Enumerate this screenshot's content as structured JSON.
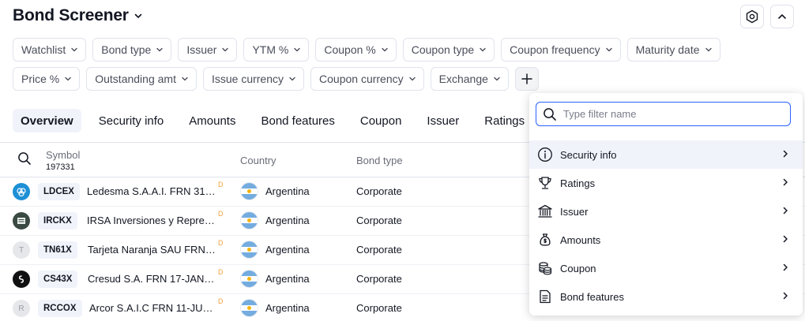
{
  "header": {
    "title": "Bond Screener"
  },
  "filters": {
    "row1": [
      "Watchlist",
      "Bond type",
      "Issuer",
      "YTM %",
      "Coupon %",
      "Coupon type",
      "Coupon frequency",
      "Maturity date"
    ],
    "row2": [
      "Price %",
      "Outstanding amt",
      "Issue currency",
      "Coupon currency",
      "Exchange"
    ]
  },
  "tabs": [
    "Overview",
    "Security info",
    "Amounts",
    "Bond features",
    "Coupon",
    "Issuer",
    "Ratings"
  ],
  "table": {
    "headers": {
      "symbol": "Symbol",
      "count": "197331",
      "country": "Country",
      "bond_type": "Bond type"
    },
    "rows": [
      {
        "symbol": "LDCEX",
        "name": "Ledesma S.A.A.I. FRN 31-…",
        "marker": "D",
        "country": "Argentina",
        "bond_type": "Corporate",
        "logo_color": "#1e90d6"
      },
      {
        "symbol": "IRCKX",
        "name": "IRSA Inversiones y Repres…",
        "marker": "D",
        "country": "Argentina",
        "bond_type": "Corporate",
        "logo_color": "#3a4a42"
      },
      {
        "symbol": "TN61X",
        "name": "Tarjeta Naranja SAU FRN …",
        "marker": "D",
        "country": "Argentina",
        "bond_type": "Corporate",
        "logo_color": "#e6e7ea",
        "logo_letter": "T"
      },
      {
        "symbol": "CS43X",
        "name": "Cresud S.A. FRN 17-JAN-…",
        "marker": "D",
        "country": "Argentina",
        "bond_type": "Corporate",
        "logo_color": "#111111"
      },
      {
        "symbol": "RCCOX",
        "name": "Arcor S.A.I.C FRN 11-JUN…",
        "marker": "D",
        "country": "Argentina",
        "bond_type": "Corporate",
        "logo_color": "#e6e7ea",
        "logo_letter": "R"
      }
    ]
  },
  "dropdown": {
    "search_placeholder": "Type filter name",
    "items": [
      {
        "label": "Security info",
        "icon": "info-icon"
      },
      {
        "label": "Ratings",
        "icon": "trophy-icon"
      },
      {
        "label": "Issuer",
        "icon": "bank-icon"
      },
      {
        "label": "Amounts",
        "icon": "money-bag-icon"
      },
      {
        "label": "Coupon",
        "icon": "coins-icon"
      },
      {
        "label": "Bond features",
        "icon": "document-icon"
      }
    ]
  },
  "colors": {
    "accent": "#2962ff",
    "flag_blue": "#74acdf",
    "flag_sun": "#f6b40e",
    "delayed_marker": "#f0a13c"
  }
}
